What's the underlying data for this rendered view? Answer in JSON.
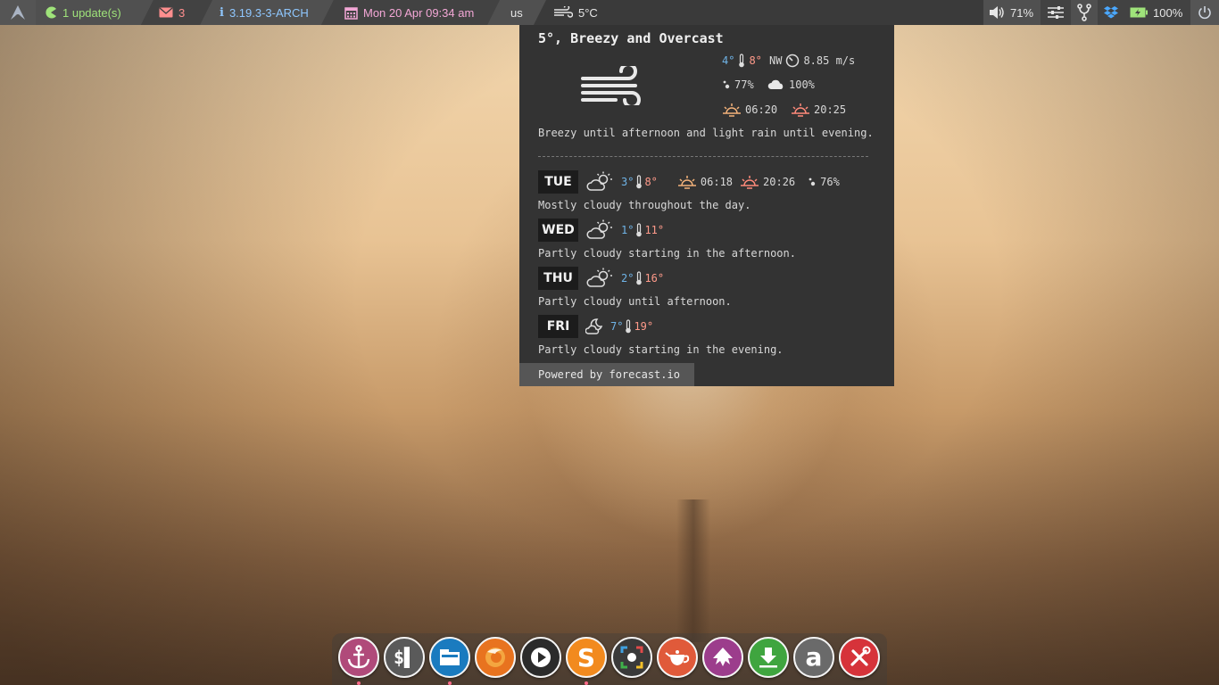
{
  "panel": {
    "updates": "1 update(s)",
    "mail_count": "3",
    "kernel": "3.19.3-3-ARCH",
    "datetime": "Mon 20 Apr 09:34 am",
    "keyboard": "us",
    "weather": "5°C",
    "volume": "71%",
    "battery": "100%"
  },
  "weather_popup": {
    "title": "5°, Breezy and Overcast",
    "current": {
      "temp_min": "4°",
      "temp_max": "8°",
      "wind_dir": "NW",
      "wind_speed": "8.85 m/s",
      "humidity": "77%",
      "cloud_cover": "100%",
      "sunrise": "06:20",
      "sunset": "20:25"
    },
    "summary": "Breezy until afternoon and light rain until evening.",
    "tuesday_extra": {
      "sunrise": "06:18",
      "sunset": "20:26",
      "humidity": "76%"
    },
    "days": [
      {
        "name": "TUE",
        "min": "3°",
        "max": "8°",
        "description": "Mostly cloudy throughout the day."
      },
      {
        "name": "WED",
        "min": "1°",
        "max": "11°",
        "description": "Partly cloudy starting in the afternoon."
      },
      {
        "name": "THU",
        "min": "2°",
        "max": "16°",
        "description": "Partly cloudy until afternoon."
      },
      {
        "name": "FRI",
        "min": "7°",
        "max": "19°",
        "description": "Partly cloudy starting in the evening."
      }
    ],
    "powered_by": "Powered by forecast.io"
  },
  "dock": {
    "icons": [
      {
        "name": "anchor-icon",
        "color": "#b04a7a"
      },
      {
        "name": "terminal-icon",
        "color": "#5a5a5a"
      },
      {
        "name": "file-manager-icon",
        "color": "#1a7bbf"
      },
      {
        "name": "firefox-icon",
        "color": "#e8731f"
      },
      {
        "name": "media-player-icon",
        "color": "#2b2b2b"
      },
      {
        "name": "sublime-icon",
        "color": "#f28a1e"
      },
      {
        "name": "screenshot-icon",
        "color": "#3a3a3a"
      },
      {
        "name": "teapot-icon",
        "color": "#e05a3a"
      },
      {
        "name": "inkscape-icon",
        "color": "#9c3d8c"
      },
      {
        "name": "download-icon",
        "color": "#3fa53f"
      },
      {
        "name": "amazon-icon",
        "color": "#6a6a6a"
      },
      {
        "name": "settings-tools-icon",
        "color": "#d6333a"
      }
    ]
  }
}
